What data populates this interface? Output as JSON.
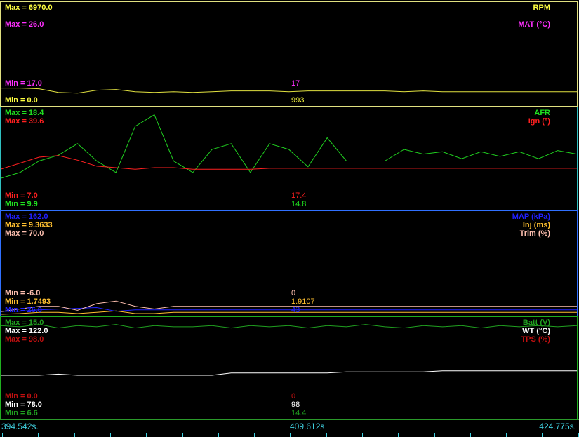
{
  "panels": [
    {
      "labels": [
        {
          "name": "RPM",
          "color": "#ffff40",
          "max": "Max = 6970.0",
          "min": "Min = 0.0",
          "cursor": "993"
        },
        {
          "name": "MAT (°C)",
          "color": "#ff30ff",
          "max": "Max = 26.0",
          "min": "Min = 17.0",
          "cursor": "17"
        }
      ],
      "border": "#e0e080"
    },
    {
      "labels": [
        {
          "name": "AFR",
          "color": "#20e020",
          "max": "Max = 18.4",
          "min": "Min = 9.9",
          "cursor": "14.8"
        },
        {
          "name": "Ign (°)",
          "color": "#ff2020",
          "max": "Max = 39.6",
          "min": "Min = 7.0",
          "cursor": "17.4"
        }
      ],
      "border": "#30c0c0"
    },
    {
      "labels": [
        {
          "name": "MAP (kPa)",
          "color": "#2020ff",
          "max": "Max = 162.0",
          "min": "Min = 26.0",
          "cursor": "43"
        },
        {
          "name": "Inj (ms)",
          "color": "#ffc030",
          "max": "Max = 9.3633",
          "min": "Min = 1.7493",
          "cursor": "1.9107"
        },
        {
          "name": "Trim (%)",
          "color": "#ffc0b0",
          "max": "Max = 70.0",
          "min": "Min = -6.0",
          "cursor": "0"
        }
      ],
      "border": "#3070ff"
    },
    {
      "labels": [
        {
          "name": "Batt (V)",
          "color": "#20a020",
          "max": "Max = 15.0",
          "min": "Min = 6.6",
          "cursor": "14.4"
        },
        {
          "name": "WT (°C)",
          "color": "#ffffff",
          "max": "Max = 122.0",
          "min": "Min = 78.0",
          "cursor": "98"
        },
        {
          "name": "TPS (%)",
          "color": "#c01010",
          "max": "Max = 98.0",
          "min": "Min = 0.0",
          "cursor": "0"
        }
      ],
      "border": "#20b020"
    }
  ],
  "time_axis": {
    "start": "394.542s.",
    "cursor": "409.612s",
    "end": "424.775s."
  },
  "chart_data": {
    "type": "line",
    "traces": [
      {
        "panel": 0,
        "color": "#e0e040",
        "range": [
          0,
          6970
        ],
        "values": [
          1150,
          1150,
          1100,
          850,
          800,
          1000,
          1050,
          900,
          850,
          900,
          850,
          900,
          950,
          950,
          950,
          900,
          950,
          950,
          950,
          950,
          950,
          900,
          950,
          900,
          900,
          900,
          900,
          900,
          900,
          900,
          900
        ]
      },
      {
        "panel": 1,
        "color": "#20d020",
        "range": [
          9.9,
          18.4
        ],
        "values": [
          12.5,
          13,
          14,
          14.5,
          15.5,
          14,
          13,
          17,
          18,
          14,
          13,
          15,
          15.5,
          13,
          15.5,
          15,
          13.5,
          16,
          14,
          14,
          14,
          15,
          14.6,
          14.8,
          14.2,
          14.8,
          14.4,
          14.8,
          14.2,
          14.9,
          14.6
        ]
      },
      {
        "panel": 1,
        "color": "#ff2020",
        "range": [
          7,
          39.6
        ],
        "values": [
          20,
          22,
          24,
          24.5,
          23,
          21,
          20.5,
          20,
          20.5,
          20.5,
          20,
          20,
          20,
          20,
          20.3,
          20.3,
          20.3,
          20.3,
          20.3,
          20.3,
          20.3,
          20.3,
          20.3,
          20.3,
          20.3,
          20.3,
          20.3,
          20.3,
          20.3,
          20.3,
          20.3
        ]
      },
      {
        "panel": 2,
        "color": "#2020ff",
        "range": [
          26,
          162
        ],
        "values": [
          30,
          30,
          32,
          33,
          34,
          35,
          30,
          32,
          32,
          32,
          32,
          32,
          32,
          32,
          32,
          32,
          32,
          32,
          32,
          32,
          32,
          32,
          32,
          32,
          32,
          32,
          32,
          32,
          32,
          32,
          32
        ]
      },
      {
        "panel": 2,
        "color": "#ffc0b0",
        "range": [
          -6,
          70
        ],
        "values": [
          -4,
          -2,
          0,
          0,
          -3,
          2,
          4,
          0,
          -2,
          0,
          0,
          0,
          0,
          0,
          0,
          0,
          0,
          0,
          0,
          0,
          0,
          0,
          0,
          0,
          0,
          0,
          0,
          0,
          0,
          0,
          0
        ]
      },
      {
        "panel": 2,
        "color": "#ffc030",
        "range": [
          1.7493,
          9.3633
        ],
        "values": [
          1.75,
          1.8,
          1.9,
          1.9,
          1.8,
          1.9,
          2,
          1.8,
          1.8,
          1.9,
          1.9,
          1.9,
          1.9,
          1.9,
          1.9,
          1.9,
          1.9,
          1.9,
          1.9,
          1.9,
          1.9,
          1.9,
          1.9,
          1.9,
          1.9,
          1.9,
          1.9,
          1.9,
          1.9,
          1.9,
          1.9
        ]
      },
      {
        "panel": 3,
        "color": "#20a020",
        "range": [
          6.6,
          15
        ],
        "values": [
          14.5,
          14.4,
          14.6,
          14.3,
          14.5,
          14.4,
          14.6,
          14.3,
          14.5,
          14.4,
          14.4,
          14.5,
          14.3,
          14.5,
          14.4,
          14.5,
          14.3,
          14.5,
          14.4,
          14.6,
          14.4,
          14.3,
          14.5,
          14.4,
          14.5,
          14.3,
          14.5,
          14.4,
          14.5,
          14.4,
          14.5
        ]
      },
      {
        "panel": 3,
        "color": "#ffffff",
        "range": [
          78,
          122
        ],
        "values": [
          97,
          97,
          97,
          97.5,
          97,
          97,
          97,
          97,
          97,
          97,
          97,
          97,
          98,
          98,
          98,
          98,
          98,
          98,
          98.5,
          98.5,
          98.5,
          98.5,
          98.5,
          99,
          99,
          99,
          99,
          99,
          99,
          99,
          99
        ]
      }
    ]
  }
}
